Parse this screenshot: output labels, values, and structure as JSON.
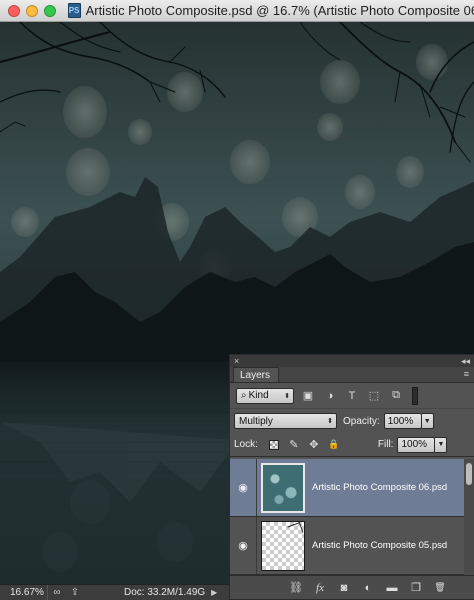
{
  "window": {
    "title": "Artistic Photo Composite.psd @ 16.7% (Artistic Photo Composite 06",
    "doc_icon": "PS"
  },
  "status": {
    "zoom": "16.67%",
    "doc_size": "Doc: 33.2M/1.49G"
  },
  "layers_panel": {
    "tab": "Layers",
    "filter_kind": "Kind",
    "blend_mode": "Multiply",
    "opacity_label": "Opacity:",
    "opacity_value": "100%",
    "lock_label": "Lock:",
    "fill_label": "Fill:",
    "fill_value": "100%",
    "layers": [
      {
        "name": "Artistic Photo Composite 06.psd",
        "visible": true,
        "selected": true
      },
      {
        "name": "Artistic Photo Composite 05.psd",
        "visible": true,
        "selected": false
      }
    ]
  },
  "icons": {
    "close": "×",
    "collapse": "◂◂",
    "menu": "≡",
    "eye": "👁",
    "image_filter": "▣",
    "adjust_filter": "◑",
    "type_filter": "T",
    "shape_filter": "⬚",
    "smart_filter": "⧉",
    "lock_brush": "✎",
    "lock_move": "✥",
    "lock_all": "🔒",
    "link": "⛓",
    "fx": "fx",
    "mask": "◙",
    "adjust": "◐",
    "folder": "▬",
    "new": "❐",
    "trash": "🗑",
    "share": "⇪",
    "binoculars": "∞"
  }
}
